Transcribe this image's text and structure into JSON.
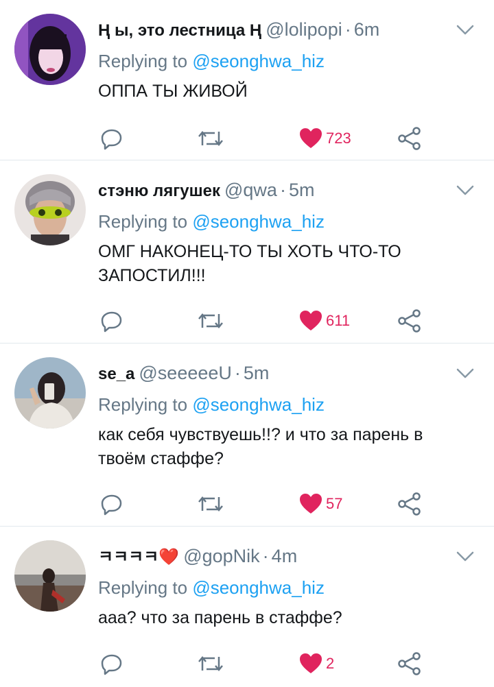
{
  "tweets": [
    {
      "name": "Ⱨ ы, это лестница Ⱨ",
      "handle": "@lolipopi",
      "dot": "·",
      "time": "6m",
      "replying_prefix": "Replying to",
      "replying_to": "@seonghwa_hiz",
      "text": "ОППА ТЫ ЖИВОЙ",
      "likes": "723"
    },
    {
      "name": "стэню лягушек",
      "handle": "@qwa",
      "dot": "·",
      "time": "5m",
      "replying_prefix": "Replying to",
      "replying_to": "@seonghwa_hiz",
      "text": "ОМГ НАКОНЕЦ-ТО ТЫ ХОТЬ ЧТО-ТО ЗАПОСТИЛ!!!",
      "likes": "611"
    },
    {
      "name": "se_a",
      "handle": "@seeeeeU",
      "dot": "·",
      "time": "5m",
      "replying_prefix": "Replying to",
      "replying_to": "@seonghwa_hiz",
      "text": "как себя чувствуешь!!? и что за парень в твоём стаффе?",
      "likes": "57"
    },
    {
      "name": "ㅋㅋㅋㅋ❤️",
      "handle": "@gopNik",
      "dot": "·",
      "time": "4m",
      "replying_prefix": "Replying to",
      "replying_to": "@seonghwa_hiz",
      "text": "ааа? что за парень в стаффе?",
      "likes": "2"
    }
  ],
  "colors": {
    "accent": "#1da1f2",
    "like": "#e0245e",
    "muted": "#657786",
    "icon": "#657786",
    "text": "#14171a",
    "divider": "#e1e8ed"
  },
  "icons": {
    "reply": "reply-icon",
    "retweet": "retweet-icon",
    "like": "heart-icon",
    "share": "share-icon",
    "menu": "chevron-down-icon"
  }
}
